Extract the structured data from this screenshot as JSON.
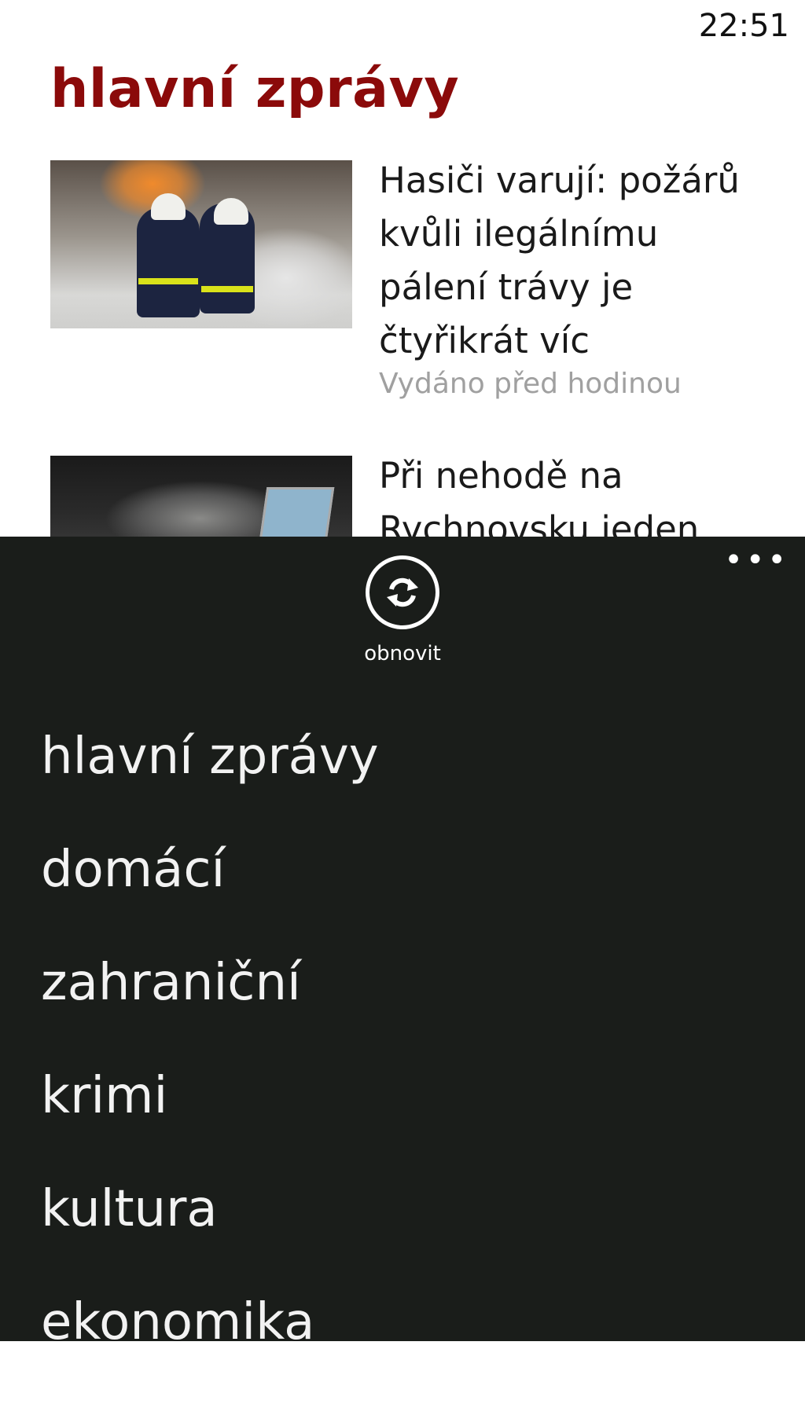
{
  "status_bar": {
    "time": "22:51"
  },
  "page": {
    "title": "hlavní zprávy"
  },
  "articles": [
    {
      "headline": "Hasiči varují: požárů kvůli ilegálnímu pálení trávy je čtyřikrát víc",
      "meta": "Vydáno před hodinou"
    },
    {
      "headline": "Při nehodě na Rychnovsku jeden"
    }
  ],
  "app_bar": {
    "more_icon": "ellipsis-icon",
    "refresh": {
      "icon": "refresh-icon",
      "label": "obnovit"
    }
  },
  "menu": {
    "items": [
      {
        "label": "hlavní zprávy"
      },
      {
        "label": "domácí"
      },
      {
        "label": "zahraniční"
      },
      {
        "label": "krimi"
      },
      {
        "label": "kultura"
      },
      {
        "label": "ekonomika"
      }
    ]
  },
  "colors": {
    "accent": "#8b0a0a",
    "app_bar_bg": "#1a1d1a",
    "meta_text": "#a0a0a0"
  }
}
